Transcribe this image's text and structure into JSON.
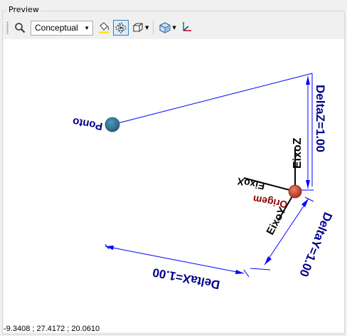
{
  "panel": {
    "title": "Preview"
  },
  "toolbar": {
    "zoom_icon": "magnifier-icon",
    "visual_style": "Conceptual",
    "fill_icon": "paint-bucket-icon",
    "orbit_icon": "orbit-icon",
    "view_cube_icon": "box-view-icon",
    "projection_icon": "projection-cube-icon",
    "axes_icon": "ucs-axes-icon"
  },
  "scene": {
    "point_label": "Ponto",
    "origin_label": "Origem",
    "axis_x_label": "EixoX",
    "axis_y_label": "EixoY",
    "axis_z_label": "EixoZ",
    "dim_x": "DeltaX=1.00",
    "dim_y": "DeltaY=1.00",
    "dim_z": "DeltaZ=1.00",
    "colors": {
      "dimension": "#0000ff",
      "dimension_text": "#00008b",
      "origin_text": "#8b0000",
      "axis": "#000000"
    }
  },
  "status": {
    "coordinates": "-9.3408 ; 27.4172 ; 20.0610"
  }
}
